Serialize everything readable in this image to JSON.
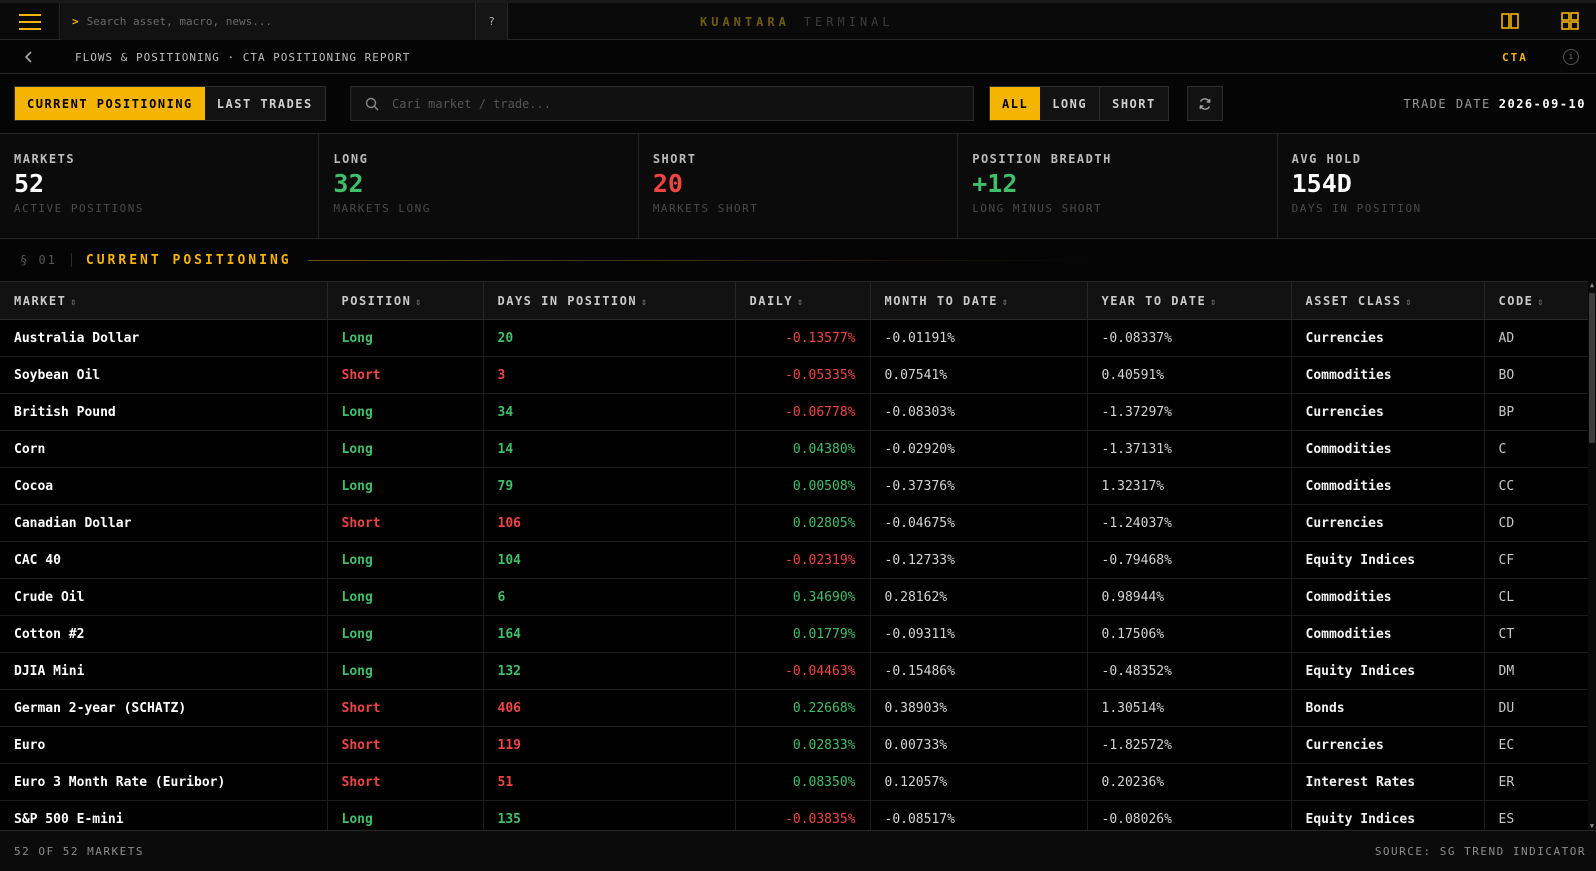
{
  "topbar": {
    "search_placeholder": "Search asset, macro, news...",
    "help_label": "?",
    "brand_primary": "KUANTARA",
    "brand_secondary": "TERMINAL"
  },
  "breadcrumb": {
    "text": "FLOWS & POSITIONING · CTA POSITIONING REPORT",
    "tag": "CTA",
    "info_label": "i"
  },
  "controls": {
    "view_tabs": [
      "CURRENT POSITIONING",
      "LAST TRADES"
    ],
    "search_placeholder": "Cari market / trade...",
    "filters": [
      "ALL",
      "LONG",
      "SHORT"
    ],
    "trade_date_label": "TRADE DATE",
    "trade_date_value": "2026-09-10"
  },
  "stats": [
    {
      "label": "MARKETS",
      "value": "52",
      "sub": "ACTIVE POSITIONS",
      "tone": "neutral"
    },
    {
      "label": "LONG",
      "value": "32",
      "sub": "MARKETS LONG",
      "tone": "green"
    },
    {
      "label": "SHORT",
      "value": "20",
      "sub": "MARKETS SHORT",
      "tone": "red"
    },
    {
      "label": "POSITION BREADTH",
      "value": "+12",
      "sub": "LONG MINUS SHORT",
      "tone": "green"
    },
    {
      "label": "AVG HOLD",
      "value": "154D",
      "sub": "DAYS IN POSITION",
      "tone": "neutral"
    }
  ],
  "section": {
    "number": "§ 01",
    "title": "CURRENT POSITIONING"
  },
  "table": {
    "columns": [
      "MARKET",
      "POSITION",
      "DAYS IN POSITION",
      "DAILY",
      "MONTH TO DATE",
      "YEAR TO DATE",
      "ASSET CLASS",
      "CODE"
    ],
    "sort_glyph": "⇕",
    "rows": [
      {
        "market": "Australia Dollar",
        "position": "Long",
        "days": "20",
        "daily": "-0.13577%",
        "mtd": "-0.01191%",
        "ytd": "-0.08337%",
        "asset_class": "Currencies",
        "code": "AD"
      },
      {
        "market": "Soybean Oil",
        "position": "Short",
        "days": "3",
        "daily": "-0.05335%",
        "mtd": "0.07541%",
        "ytd": "0.40591%",
        "asset_class": "Commodities",
        "code": "BO"
      },
      {
        "market": "British Pound",
        "position": "Long",
        "days": "34",
        "daily": "-0.06778%",
        "mtd": "-0.08303%",
        "ytd": "-1.37297%",
        "asset_class": "Currencies",
        "code": "BP"
      },
      {
        "market": "Corn",
        "position": "Long",
        "days": "14",
        "daily": "0.04380%",
        "mtd": "-0.02920%",
        "ytd": "-1.37131%",
        "asset_class": "Commodities",
        "code": "C"
      },
      {
        "market": "Cocoa",
        "position": "Long",
        "days": "79",
        "daily": "0.00508%",
        "mtd": "-0.37376%",
        "ytd": "1.32317%",
        "asset_class": "Commodities",
        "code": "CC"
      },
      {
        "market": "Canadian Dollar",
        "position": "Short",
        "days": "106",
        "daily": "0.02805%",
        "mtd": "-0.04675%",
        "ytd": "-1.24037%",
        "asset_class": "Currencies",
        "code": "CD"
      },
      {
        "market": "CAC 40",
        "position": "Long",
        "days": "104",
        "daily": "-0.02319%",
        "mtd": "-0.12733%",
        "ytd": "-0.79468%",
        "asset_class": "Equity Indices",
        "code": "CF"
      },
      {
        "market": "Crude Oil",
        "position": "Long",
        "days": "6",
        "daily": "0.34690%",
        "mtd": "0.28162%",
        "ytd": "0.98944%",
        "asset_class": "Commodities",
        "code": "CL"
      },
      {
        "market": "Cotton #2",
        "position": "Long",
        "days": "164",
        "daily": "0.01779%",
        "mtd": "-0.09311%",
        "ytd": "0.17506%",
        "asset_class": "Commodities",
        "code": "CT"
      },
      {
        "market": "DJIA Mini",
        "position": "Long",
        "days": "132",
        "daily": "-0.04463%",
        "mtd": "-0.15486%",
        "ytd": "-0.48352%",
        "asset_class": "Equity Indices",
        "code": "DM"
      },
      {
        "market": "German 2-year (SCHATZ)",
        "position": "Short",
        "days": "406",
        "daily": "0.22668%",
        "mtd": "0.38903%",
        "ytd": "1.30514%",
        "asset_class": "Bonds",
        "code": "DU"
      },
      {
        "market": "Euro",
        "position": "Short",
        "days": "119",
        "daily": "0.02833%",
        "mtd": "0.00733%",
        "ytd": "-1.82572%",
        "asset_class": "Currencies",
        "code": "EC"
      },
      {
        "market": "Euro 3 Month Rate (Euribor)",
        "position": "Short",
        "days": "51",
        "daily": "0.08350%",
        "mtd": "0.12057%",
        "ytd": "0.20236%",
        "asset_class": "Interest Rates",
        "code": "ER"
      },
      {
        "market": "S&P 500 E-mini",
        "position": "Long",
        "days": "135",
        "daily": "-0.03835%",
        "mtd": "-0.08517%",
        "ytd": "-0.08026%",
        "asset_class": "Equity Indices",
        "code": "ES"
      }
    ]
  },
  "footer": {
    "count": "52 OF 52 MARKETS",
    "source": "SOURCE: SG TREND INDICATOR"
  },
  "colors": {
    "accent": "#f5b400",
    "positive": "#3fbf6a",
    "negative": "#ef4444",
    "background": "#000000"
  },
  "icons": {
    "menu": "hamburger-icon",
    "columns": "columns-layout-icon",
    "grid": "grid-layout-icon",
    "back": "chevron-left-icon",
    "info": "info-icon",
    "search": "search-icon",
    "refresh": "refresh-icon"
  }
}
